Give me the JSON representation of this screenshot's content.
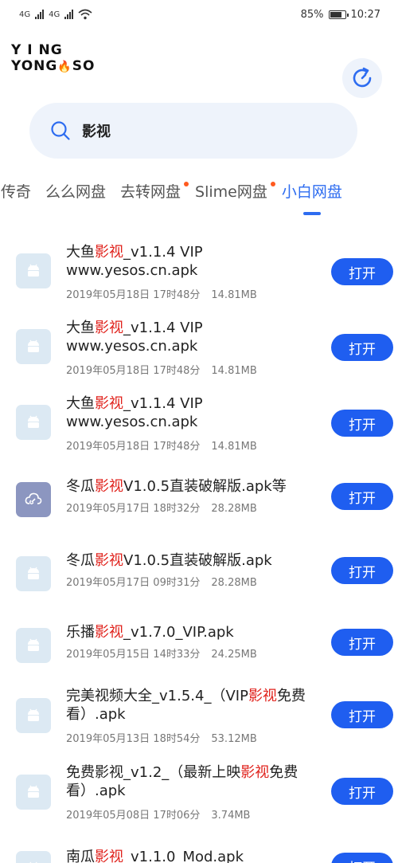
{
  "status": {
    "network_a": "4G",
    "network_b": "4G",
    "battery": "85%",
    "time": "10:27"
  },
  "logo": {
    "line1": "Y I NG",
    "line2_a": "YONG",
    "line2_b": "SO"
  },
  "search": {
    "query": "影视",
    "placeholder": ""
  },
  "tabs": [
    {
      "label": "传奇",
      "dot": false,
      "active": false
    },
    {
      "label": "么么网盘",
      "dot": false,
      "active": false
    },
    {
      "label": "去转网盘",
      "dot": true,
      "active": false
    },
    {
      "label": "Slime网盘",
      "dot": true,
      "active": false
    },
    {
      "label": "小白网盘",
      "dot": false,
      "active": true
    }
  ],
  "open_label": "打开",
  "results": [
    {
      "icon": "android-icon",
      "pre": "大鱼",
      "hl": "影视",
      "post": "_v1.1.4 VIP www.yesos.cn.apk",
      "date": "2019年05月18日 17时48分",
      "size": "14.81MB"
    },
    {
      "icon": "android-icon",
      "pre": "大鱼",
      "hl": "影视",
      "post": "_v1.1.4 VIP www.yesos.cn.apk",
      "date": "2019年05月18日 17时48分",
      "size": "14.81MB"
    },
    {
      "icon": "android-icon",
      "pre": "大鱼",
      "hl": "影视",
      "post": "_v1.1.4 VIP www.yesos.cn.apk",
      "date": "2019年05月18日 17时48分",
      "size": "14.81MB"
    },
    {
      "icon": "cloud-link-icon",
      "pre": "冬瓜",
      "hl": "影视",
      "post": "V1.0.5直装破解版.apk等",
      "date": "2019年05月17日 18时32分",
      "size": "28.28MB"
    },
    {
      "icon": "android-icon",
      "pre": "冬瓜",
      "hl": "影视",
      "post": "V1.0.5直装破解版.apk",
      "date": "2019年05月17日 09时31分",
      "size": "28.28MB"
    },
    {
      "icon": "android-icon",
      "pre": "乐播",
      "hl": "影视",
      "post": "_v1.7.0_VIP.apk",
      "date": "2019年05月15日 14时33分",
      "size": "24.25MB"
    },
    {
      "icon": "android-icon",
      "pre": "完美视频大全_v1.5.4_（VIP",
      "hl": "影视",
      "post": "免费看）.apk",
      "date": "2019年05月13日 18时54分",
      "size": "53.12MB"
    },
    {
      "icon": "android-icon",
      "pre": "免费影视_v1.2_（最新上映",
      "hl": "影视",
      "post": "免费看）.apk",
      "date": "2019年05月08日 17时06分",
      "size": "3.74MB"
    },
    {
      "icon": "android-icon",
      "pre": "南瓜",
      "hl": "影视",
      "post": "_v1.1.0_Mod.apk",
      "date": "",
      "size": ""
    }
  ]
}
